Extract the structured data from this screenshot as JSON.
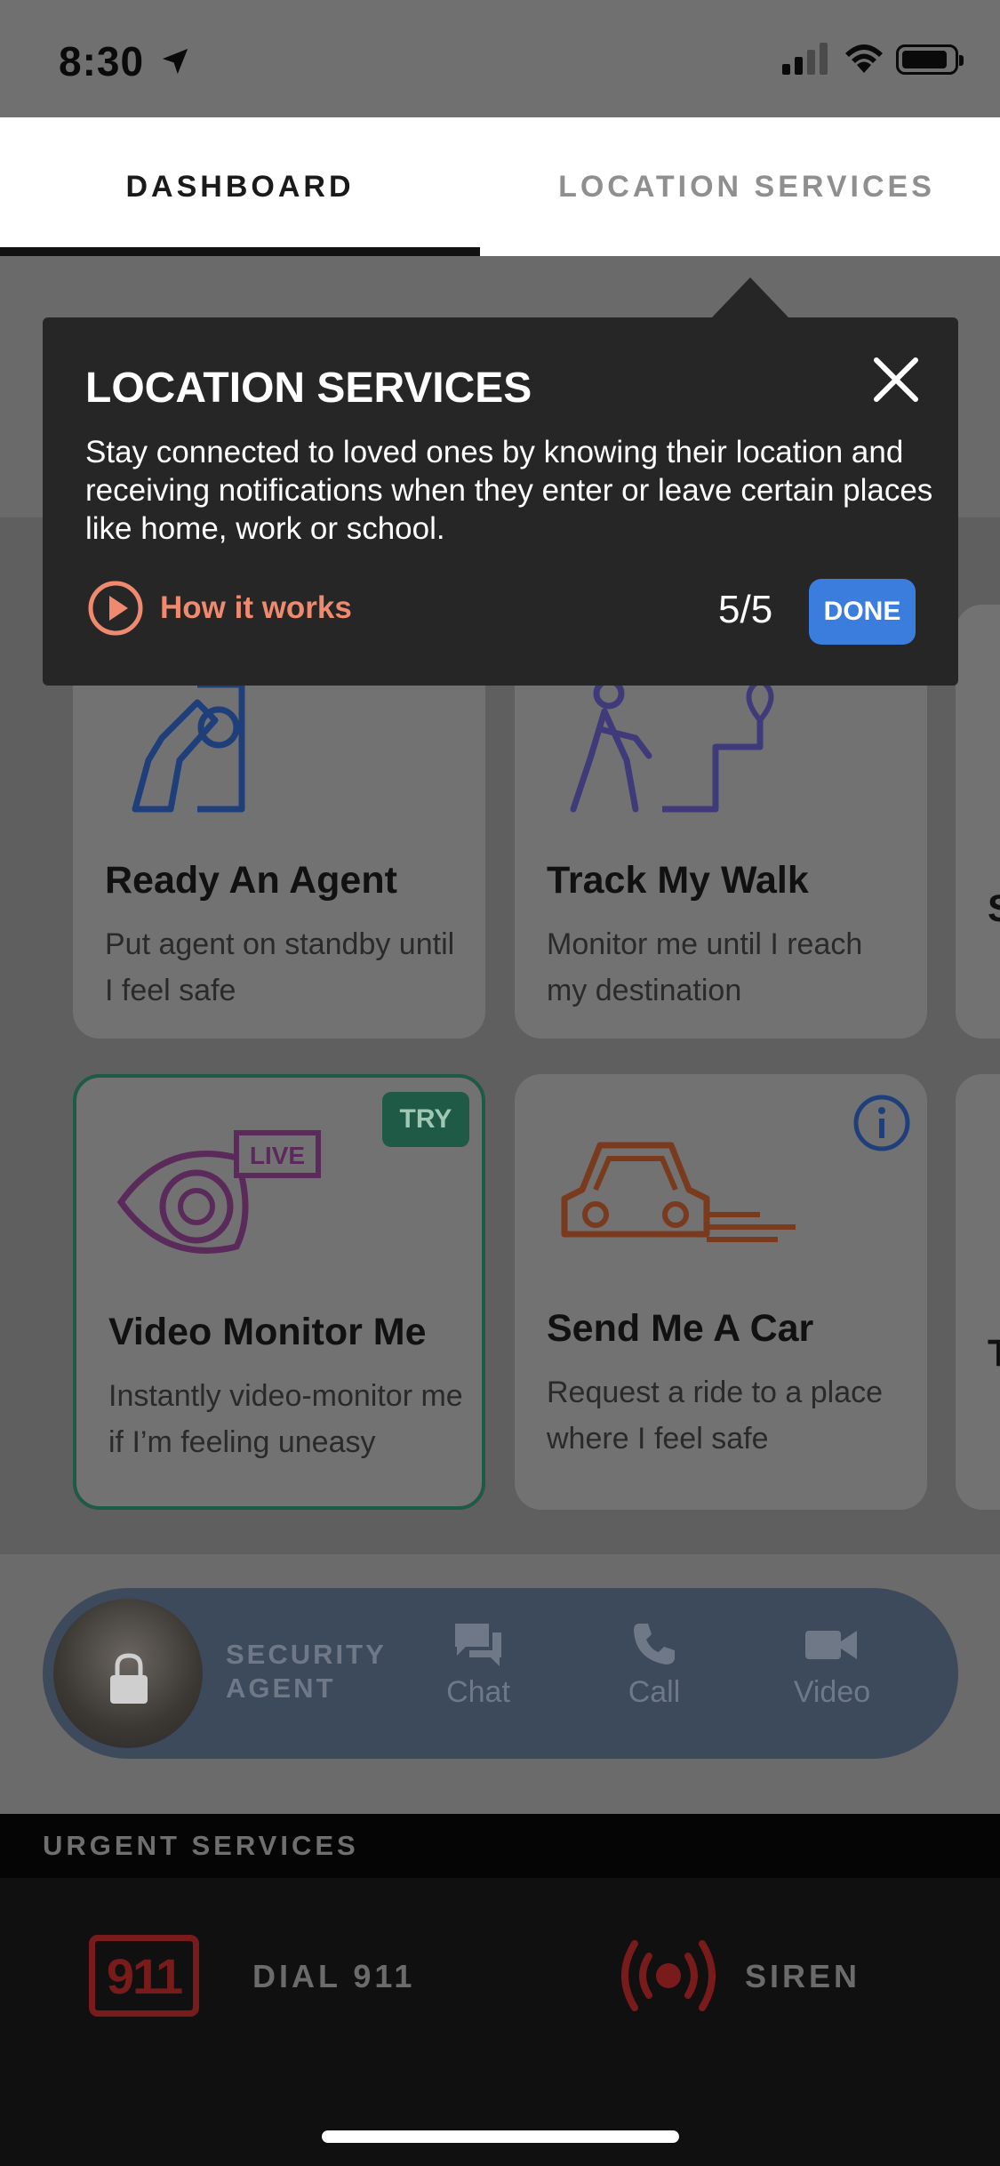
{
  "status_bar": {
    "time": "8:30"
  },
  "tabs": [
    {
      "label": "DASHBOARD",
      "active": true
    },
    {
      "label": "LOCATION SERVICES",
      "active": false
    }
  ],
  "tooltip": {
    "title": "LOCATION SERVICES",
    "body": "Stay connected to loved ones by knowing their location and receiving notifications when they enter or leave certain places like home, work or school.",
    "how_it_works": "How it works",
    "step": "5/5",
    "done_label": "DONE"
  },
  "cards": [
    {
      "title": "Ready An Agent",
      "desc": "Put agent on standby until I feel safe",
      "icon": "hand-phone-icon"
    },
    {
      "title": "Track My Walk",
      "desc": "Monitor me until I reach my destination",
      "icon": "walking-route-icon"
    },
    {
      "title": "Video Monitor Me",
      "desc": "Instantly video-monitor me if I’m feeling uneasy",
      "badge": "TRY",
      "live_label": "LIVE",
      "icon": "live-eye-icon"
    },
    {
      "title": "Send Me A Car",
      "desc": "Request a ride to a place where I feel safe",
      "icon": "car-icon"
    }
  ],
  "edge_cards": [
    {
      "initial": "S"
    },
    {
      "initial": "T"
    }
  ],
  "agent": {
    "label": "SECURITY AGENT",
    "actions": [
      {
        "label": "Chat"
      },
      {
        "label": "Call"
      },
      {
        "label": "Video"
      }
    ]
  },
  "urgent": {
    "title": "URGENT SERVICES",
    "dial_badge": "911",
    "dial_label": "DIAL 911",
    "siren_label": "SIREN"
  },
  "colors": {
    "accent_blue": "#3b7ddd",
    "how_it_works": "#f08a6e",
    "try_green": "#1e5a46",
    "urgent_red": "#7a1b1b"
  }
}
